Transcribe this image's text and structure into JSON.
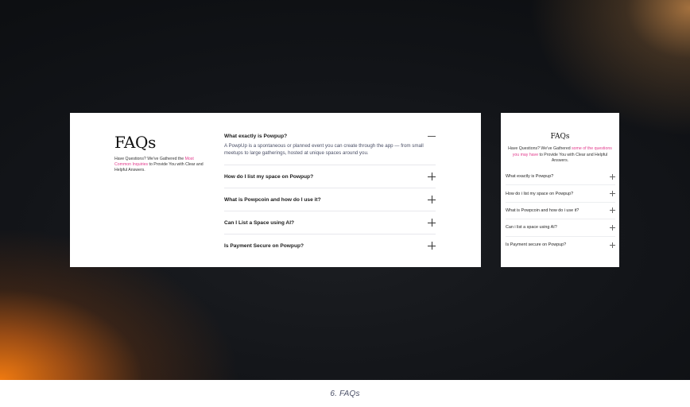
{
  "caption": "6. FAQs",
  "desktop": {
    "title": "FAQs",
    "subtitle_prefix": "Have Questions? We've Gathered the ",
    "subtitle_highlight": "Most Common Inquiries",
    "subtitle_suffix": " to Provide You with Clear and Helpful Answers.",
    "items": [
      {
        "question": "What exactly is Powpup?",
        "answer": "A PowpUp is a spontaneous or planned event you can create through the app — from small meetups to large gatherings, hosted at unique spaces around you.",
        "open": true
      },
      {
        "question": "How do I list my space on Powpup?",
        "open": false
      },
      {
        "question": "What is Powpcoin and how do I use it?",
        "open": false
      },
      {
        "question": "Can I List a Space using AI?",
        "open": false
      },
      {
        "question": "Is Payment Secure on Powpup?",
        "open": false
      }
    ]
  },
  "mobile": {
    "title": "FAQs",
    "subtitle_prefix": "Have Questions? We've Gathered ",
    "subtitle_highlight": "some of the questions you may have",
    "subtitle_suffix": " to Provide You with Clear and Helpful Answers.",
    "items": [
      {
        "question": "What exactly is Powpup?"
      },
      {
        "question": "How do i list my space on Powpup?"
      },
      {
        "question": "What is Powpcoin and how do i use it?"
      },
      {
        "question": "Can i list a space using AI?"
      },
      {
        "question": "Is Payment secure on Powpup?"
      }
    ]
  },
  "colors": {
    "accent": "#e23a8c",
    "caption": "#4a4f66"
  },
  "icons": {
    "expand": "plus-icon",
    "collapse": "minus-icon"
  }
}
